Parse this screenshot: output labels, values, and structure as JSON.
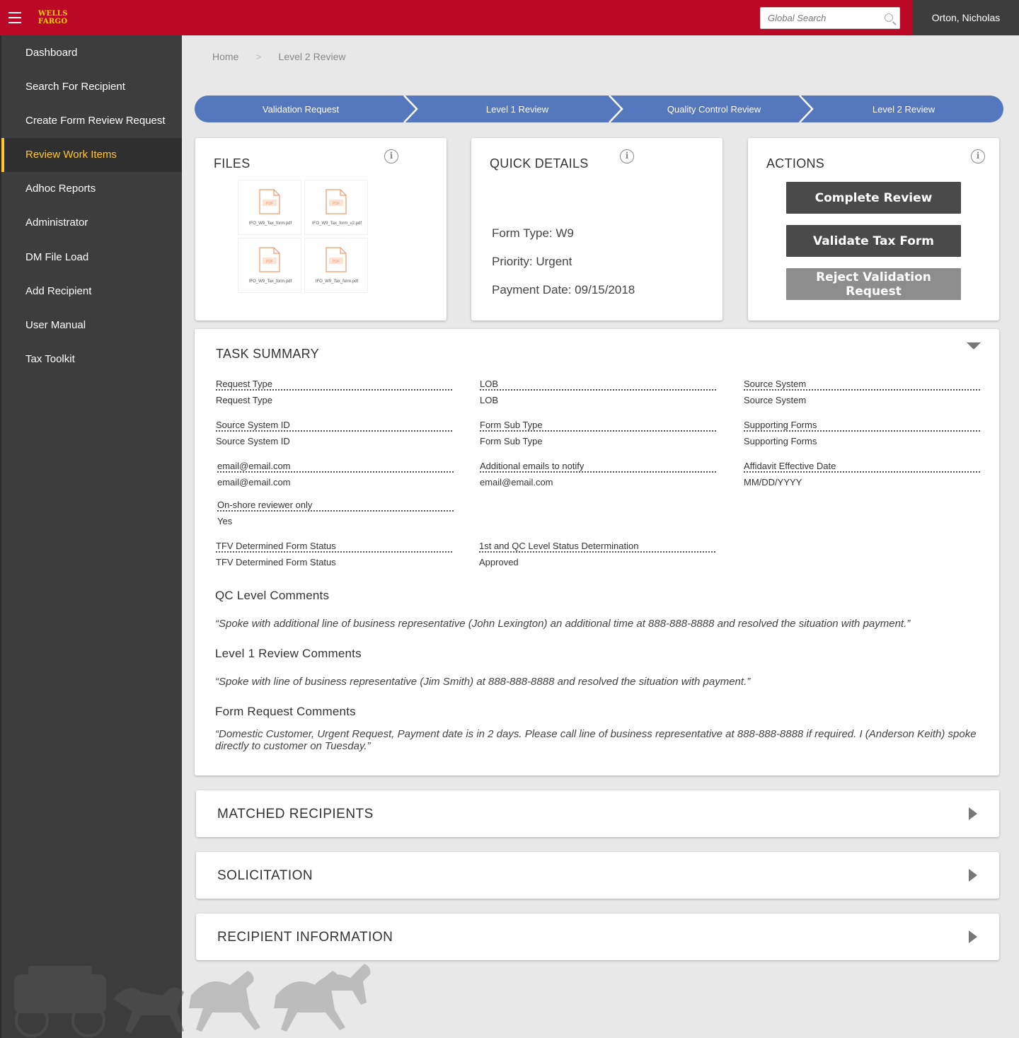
{
  "header": {
    "logo_line1": "WELLS",
    "logo_line2": "FARGO",
    "search_placeholder": "Global Search",
    "user_name": "Orton, Nicholas",
    "brand_color": "#bb0826",
    "logo_color": "#ffd200"
  },
  "sidebar": {
    "items": [
      {
        "label": "Dashboard"
      },
      {
        "label": "Search For Recipient"
      },
      {
        "label": "Create Form Review Request"
      },
      {
        "label": "Review Work Items",
        "active": true
      },
      {
        "label": "Adhoc Reports"
      },
      {
        "label": "Administrator"
      },
      {
        "label": "DM File Load"
      },
      {
        "label": "Add Recipient"
      },
      {
        "label": "User Manual"
      },
      {
        "label": "Tax Toolkit"
      }
    ],
    "active_color": "#ffc72c"
  },
  "breadcrumb": {
    "home": "Home",
    "current": "Level 2 Review"
  },
  "steps": [
    {
      "label": "Validation Request"
    },
    {
      "label": "Level 1 Review"
    },
    {
      "label": "Quality Control Review"
    },
    {
      "label": "Level 2 Review"
    }
  ],
  "files": {
    "title": "FILES",
    "items": [
      {
        "name": "IFO_W9_Tax_form.pdf"
      },
      {
        "name": "IFO_W9_Tax_form_v2.pdf"
      },
      {
        "name": "IFO_W9_Tax_form.pdf"
      },
      {
        "name": "IFO_W9_Tax_form.pdf"
      }
    ],
    "pdf_badge": "PDF"
  },
  "quick_details": {
    "title": "QUICK DETAILS",
    "form_type": "Form Type: W9",
    "priority": "Priority: Urgent",
    "payment_date": "Payment Date: 09/15/2018"
  },
  "actions": {
    "title": "ACTIONS",
    "complete": "Complete Review",
    "validate": "Validate Tax Form",
    "reject": "Reject Validation Request"
  },
  "task_summary": {
    "title": "TASK SUMMARY",
    "fields": [
      {
        "label": "Request Type",
        "value": "Request Type"
      },
      {
        "label": "LOB",
        "value": "LOB"
      },
      {
        "label": "Source System",
        "value": "Source System"
      },
      {
        "label": "Source System ID",
        "value": "Source System ID"
      },
      {
        "label": "Form Sub Type",
        "value": "Form Sub Type"
      },
      {
        "label": "Supporting Forms",
        "value": "Supporting Forms"
      },
      {
        "label": "email@email.com",
        "value": "email@email.com"
      },
      {
        "label": "Additional emails to notify",
        "value": "email@email.com"
      },
      {
        "label": "Affidavit Effective Date",
        "value": "MM/DD/YYYY"
      },
      {
        "label": "On-shore reviewer only",
        "value": "Yes"
      },
      {
        "label": "TFV Determined Form Status",
        "value": "TFV Determined Form Status"
      },
      {
        "label": "1st and QC Level Status Determination",
        "value": "Approved"
      }
    ],
    "qc_heading": "QC Level Comments",
    "qc_comment": "“Spoke with additional line of business representative (John Lexington) an additional time at 888-888-8888 and resolved the situation with payment.”",
    "l1_heading": "Level 1 Review Comments",
    "l1_comment": "“Spoke with  line of business representative (Jim Smith)  at 888-888-8888 and resolved the situation with payment.”",
    "form_heading": "Form Request Comments",
    "form_comment": "“Domestic Customer, Urgent Request, Payment date is in 2 days. Please call line of business representative at 888-888-8888 if required.  I   (Anderson Keith) spoke directly to customer on Tuesday.”"
  },
  "sections": [
    {
      "title": "MATCHED RECIPIENTS"
    },
    {
      "title": "SOLICITATION"
    },
    {
      "title": "RECIPIENT INFORMATION"
    }
  ],
  "step_color": "#5577be"
}
